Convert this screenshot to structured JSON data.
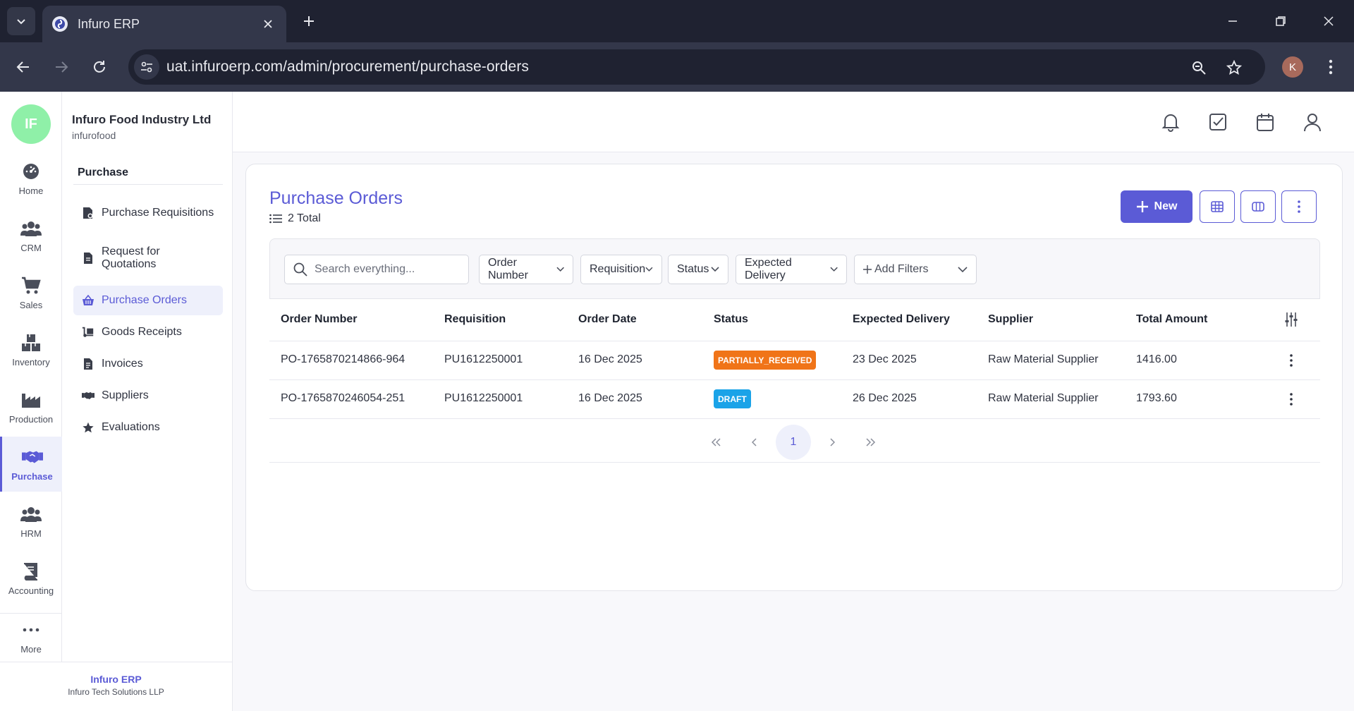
{
  "browser": {
    "tab_title": "Infuro ERP",
    "url": "uat.infuroerp.com/admin/procurement/purchase-orders",
    "profile_initial": "K"
  },
  "org": {
    "avatar": "IF",
    "name": "Infuro Food Industry Ltd",
    "slug": "infurofood"
  },
  "rail": [
    {
      "label": "Home",
      "icon": "dashboard-icon"
    },
    {
      "label": "CRM",
      "icon": "users-icon"
    },
    {
      "label": "Sales",
      "icon": "cart-icon"
    },
    {
      "label": "Inventory",
      "icon": "boxes-icon"
    },
    {
      "label": "Production",
      "icon": "factory-icon"
    },
    {
      "label": "Purchase",
      "icon": "handshake-icon",
      "active": true
    },
    {
      "label": "HRM",
      "icon": "team-icon"
    },
    {
      "label": "Accounting",
      "icon": "book-icon"
    },
    {
      "label": "More",
      "icon": "more-icon"
    }
  ],
  "subnav": {
    "section": "Purchase",
    "items": [
      {
        "label": "Purchase Requisitions",
        "icon": "file-settings-icon"
      },
      {
        "label": "Request for Quotations",
        "icon": "document-icon"
      },
      {
        "label": "Purchase Orders",
        "icon": "basket-icon",
        "active": true
      },
      {
        "label": "Goods Receipts",
        "icon": "dolly-icon"
      },
      {
        "label": "Invoices",
        "icon": "invoice-icon"
      },
      {
        "label": "Suppliers",
        "icon": "handshake-icon"
      },
      {
        "label": "Evaluations",
        "icon": "star-icon"
      }
    ]
  },
  "footer": {
    "brand": "Infuro ERP",
    "company": "Infuro Tech Solutions LLP"
  },
  "page": {
    "title": "Purchase Orders",
    "total": "2 Total",
    "new_label": "New"
  },
  "filters": {
    "search_placeholder": "Search everything...",
    "order_number": "Order Number",
    "requisition": "Requisition",
    "status": "Status",
    "expected_delivery": "Expected Delivery",
    "add_filters": "Add Filters"
  },
  "table": {
    "columns": [
      "Order Number",
      "Requisition",
      "Order Date",
      "Status",
      "Expected Delivery",
      "Supplier",
      "Total Amount"
    ],
    "rows": [
      {
        "order_number": "PO-1765870214866-964",
        "requisition": "PU1612250001",
        "order_date": "16 Dec 2025",
        "status": "PARTIALLY_RECEIVED",
        "expected_delivery": "23 Dec 2025",
        "supplier": "Raw Material Supplier",
        "total": "1416.00"
      },
      {
        "order_number": "PO-1765870246054-251",
        "requisition": "PU1612250001",
        "order_date": "16 Dec 2025",
        "status": "DRAFT",
        "expected_delivery": "26 Dec 2025",
        "supplier": "Raw Material Supplier",
        "total": "1793.60"
      }
    ]
  },
  "pagination": {
    "current": "1"
  },
  "colors": {
    "accent": "#5b5bd6",
    "partially_received": "#f07418",
    "draft": "#1aa3e8"
  }
}
